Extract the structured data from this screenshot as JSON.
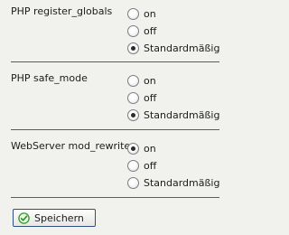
{
  "settings": [
    {
      "label": "PHP register_globals",
      "options": [
        {
          "label": "on",
          "checked": false
        },
        {
          "label": "off",
          "checked": false
        },
        {
          "label": "Standardmäßig",
          "checked": true
        }
      ]
    },
    {
      "label": "PHP safe_mode",
      "options": [
        {
          "label": "on",
          "checked": false
        },
        {
          "label": "off",
          "checked": false
        },
        {
          "label": "Standardmäßig",
          "checked": true
        }
      ]
    },
    {
      "label": "WebServer mod_rewrite",
      "options": [
        {
          "label": "on",
          "checked": true
        },
        {
          "label": "off",
          "checked": false
        },
        {
          "label": "Standardmäßig",
          "checked": false
        }
      ]
    }
  ],
  "save_button": {
    "label": "Speichern",
    "icon": "check-icon"
  },
  "colors": {
    "background": "#f1f1ed",
    "button_border": "#2f4f83",
    "check_icon": "#2e9a2a"
  }
}
